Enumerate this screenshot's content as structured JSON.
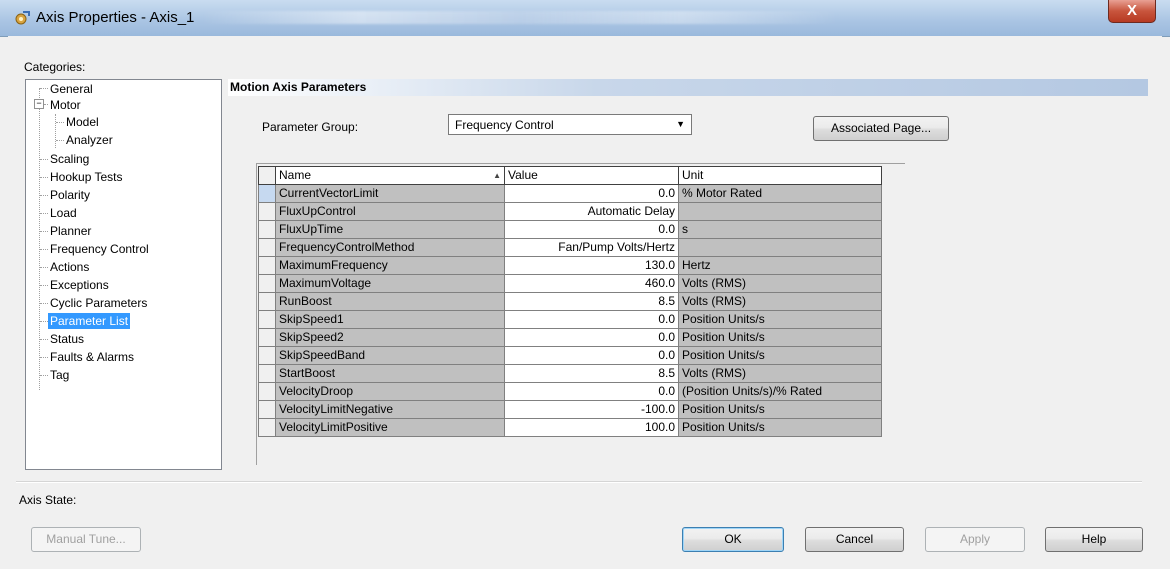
{
  "window": {
    "title": "Axis Properties - Axis_1",
    "close_label": "X"
  },
  "categories": {
    "label": "Categories:",
    "items": [
      {
        "label": "General"
      },
      {
        "label": "Motor"
      },
      {
        "label": "Model"
      },
      {
        "label": "Analyzer"
      },
      {
        "label": "Scaling"
      },
      {
        "label": "Hookup Tests"
      },
      {
        "label": "Polarity"
      },
      {
        "label": "Load"
      },
      {
        "label": "Planner"
      },
      {
        "label": "Frequency Control"
      },
      {
        "label": "Actions"
      },
      {
        "label": "Exceptions"
      },
      {
        "label": "Cyclic Parameters"
      },
      {
        "label": "Parameter List"
      },
      {
        "label": "Status"
      },
      {
        "label": "Faults & Alarms"
      },
      {
        "label": "Tag"
      }
    ],
    "selected": "Parameter List"
  },
  "section": {
    "title": "Motion Axis Parameters",
    "parameter_group_label": "Parameter Group:",
    "parameter_group_value": "Frequency Control",
    "associated_page_label": "Associated Page..."
  },
  "grid": {
    "columns": [
      "Name",
      "Value",
      "Unit"
    ],
    "rows": [
      {
        "name": "CurrentVectorLimit",
        "value": "0.0",
        "unit": "% Motor Rated"
      },
      {
        "name": "FluxUpControl",
        "value": "Automatic Delay",
        "unit": ""
      },
      {
        "name": "FluxUpTime",
        "value": "0.0",
        "unit": "s"
      },
      {
        "name": "FrequencyControlMethod",
        "value": "Fan/Pump Volts/Hertz",
        "unit": ""
      },
      {
        "name": "MaximumFrequency",
        "value": "130.0",
        "unit": "Hertz"
      },
      {
        "name": "MaximumVoltage",
        "value": "460.0",
        "unit": "Volts (RMS)"
      },
      {
        "name": "RunBoost",
        "value": "8.5",
        "unit": "Volts (RMS)"
      },
      {
        "name": "SkipSpeed1",
        "value": "0.0",
        "unit": "Position Units/s"
      },
      {
        "name": "SkipSpeed2",
        "value": "0.0",
        "unit": "Position Units/s"
      },
      {
        "name": "SkipSpeedBand",
        "value": "0.0",
        "unit": "Position Units/s"
      },
      {
        "name": "StartBoost",
        "value": "8.5",
        "unit": "Volts (RMS)"
      },
      {
        "name": "VelocityDroop",
        "value": "0.0",
        "unit": "(Position Units/s)/% Rated"
      },
      {
        "name": "VelocityLimitNegative",
        "value": "-100.0",
        "unit": "Position Units/s"
      },
      {
        "name": "VelocityLimitPositive",
        "value": "100.0",
        "unit": "Position Units/s"
      }
    ]
  },
  "footer": {
    "axis_state_label": "Axis State:",
    "manual_tune": "Manual Tune...",
    "ok": "OK",
    "cancel": "Cancel",
    "apply": "Apply",
    "help": "Help"
  }
}
